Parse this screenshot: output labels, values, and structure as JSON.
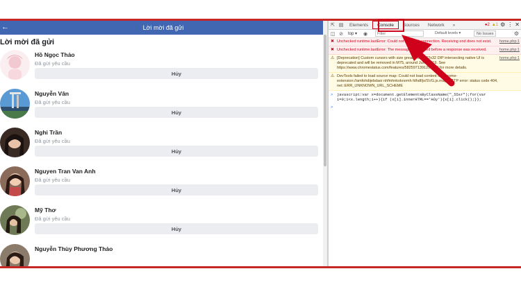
{
  "facebook": {
    "header_title": "Lời mời đã gửi",
    "back_icon": "arrow-left-icon",
    "section_title": "Lời mời đã gửi",
    "items": [
      {
        "name": "Hồ Ngọc Thảo",
        "status": "Đã gửi yêu cầu",
        "button": "Hủy",
        "avatar_color": "#f6dfe3"
      },
      {
        "name": "Nguyễn Vân",
        "status": "Đã gửi yêu cầu",
        "button": "Hủy",
        "avatar_color": "#4a88c8"
      },
      {
        "name": "Nghi Trần",
        "status": "Đã gửi yêu cầu",
        "button": "Hủy",
        "avatar_color": "#2a1f1c"
      },
      {
        "name": "Nguyen Tran Van Anh",
        "status": "Đã gửi yêu cầu",
        "button": "Hủy",
        "avatar_color": "#6b4d3e"
      },
      {
        "name": "Mỹ Thơ",
        "status": "Đã gửi yêu cầu",
        "button": "Hủy",
        "avatar_color": "#5e6b4a"
      },
      {
        "name": "Nguyễn Thùy Phương Thảo",
        "status": "",
        "button": "",
        "avatar_color": "#7a6a5a"
      }
    ]
  },
  "devtools": {
    "tabs": [
      "Elements",
      "Console",
      "Sources",
      "Network"
    ],
    "active_tab": "Console",
    "more_tabs": "»",
    "error_count": "2",
    "warning_count": "1",
    "context": "top",
    "filter_placeholder": "Filter",
    "default_levels": "Default levels ▾",
    "issues": "No Issues",
    "messages": [
      {
        "type": "error",
        "text": "Unchecked runtime.lastError: Could not establish connection. Receiving end does not exist.",
        "source": "home.php:1"
      },
      {
        "type": "error",
        "text": "Unchecked runtime.lastError: The message port closed before a response was received.",
        "source": "home.php:1"
      },
      {
        "type": "warn",
        "text": "[Deprecation] Custom cursors with size greater than 32x32 DIP intersecting native UI is deprecated and will be removed in M75, around June 2019. See https://www.chromestatus.com/features/5825971391299584 for more details.",
        "source": "home.php:1"
      },
      {
        "type": "warn",
        "text": "DevTools failed to load source map: Could not load content for chrome-extension://amfohdijebdaoi nhfmhnkoknomh fdhdf/js/SVG.js.map: HTTP error: status code 404, net::ERR_UNKNOWN_URL_SCHEME",
        "source": ""
      }
    ],
    "command": "javascript:var x=document.getElementsByClassName(\"_55sr\");for(var i=0;i<x.length;i++){if (x[i].innerHTML=='Hủy'){x[i].click();}};"
  },
  "annotation_color": "#d0021b"
}
